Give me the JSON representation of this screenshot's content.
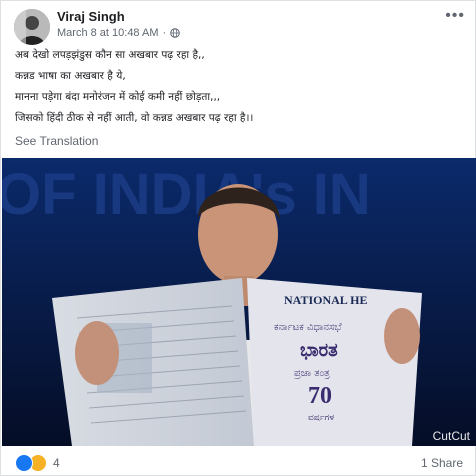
{
  "post": {
    "author": "Viraj Singh",
    "timestamp": "March 8 at 10:48 AM",
    "separator": "·",
    "caption_lines": [
      "अब देखो लपड़झंडुस कौन सा अखबार पढ़ रहा है,,",
      "कन्नड भाषा का अखबार है ये,",
      "मानना पड़ेगा बंदा मनोरंजन में कोई कमी नहीं छोड़ता,,,",
      "जिसको हिंदी ठीक से नहीं आती, वो कन्नड अखबार पढ़ रहा है।।"
    ],
    "see_translation": "See Translation",
    "privacy_icon": "globe-icon",
    "more_icon": "ellipsis-icon"
  },
  "photo": {
    "backdrop_text": "OF INDIA's IN",
    "newspaper_masthead": "NATIONAL HE",
    "kannada_line1": "ಕರ್ನಾಟಕ ವಿಧಾನಸಭೆ",
    "kannada_title": "ಭಾರತ",
    "kannada_line3": "ಪ್ರಜಾ ತಂತ್ರ",
    "kannada_number": "70",
    "kannada_line5": "ವರ್ಷಗಳ",
    "watermark": "CutCut"
  },
  "footer": {
    "reaction_icons": [
      "like-icon",
      "haha-icon"
    ],
    "reaction_count": "4",
    "shares": "1 Share"
  },
  "colors": {
    "link_gray": "#606770",
    "text": "#1c1e21",
    "like_blue": "#1877f2",
    "haha_yellow": "#f7b125"
  }
}
